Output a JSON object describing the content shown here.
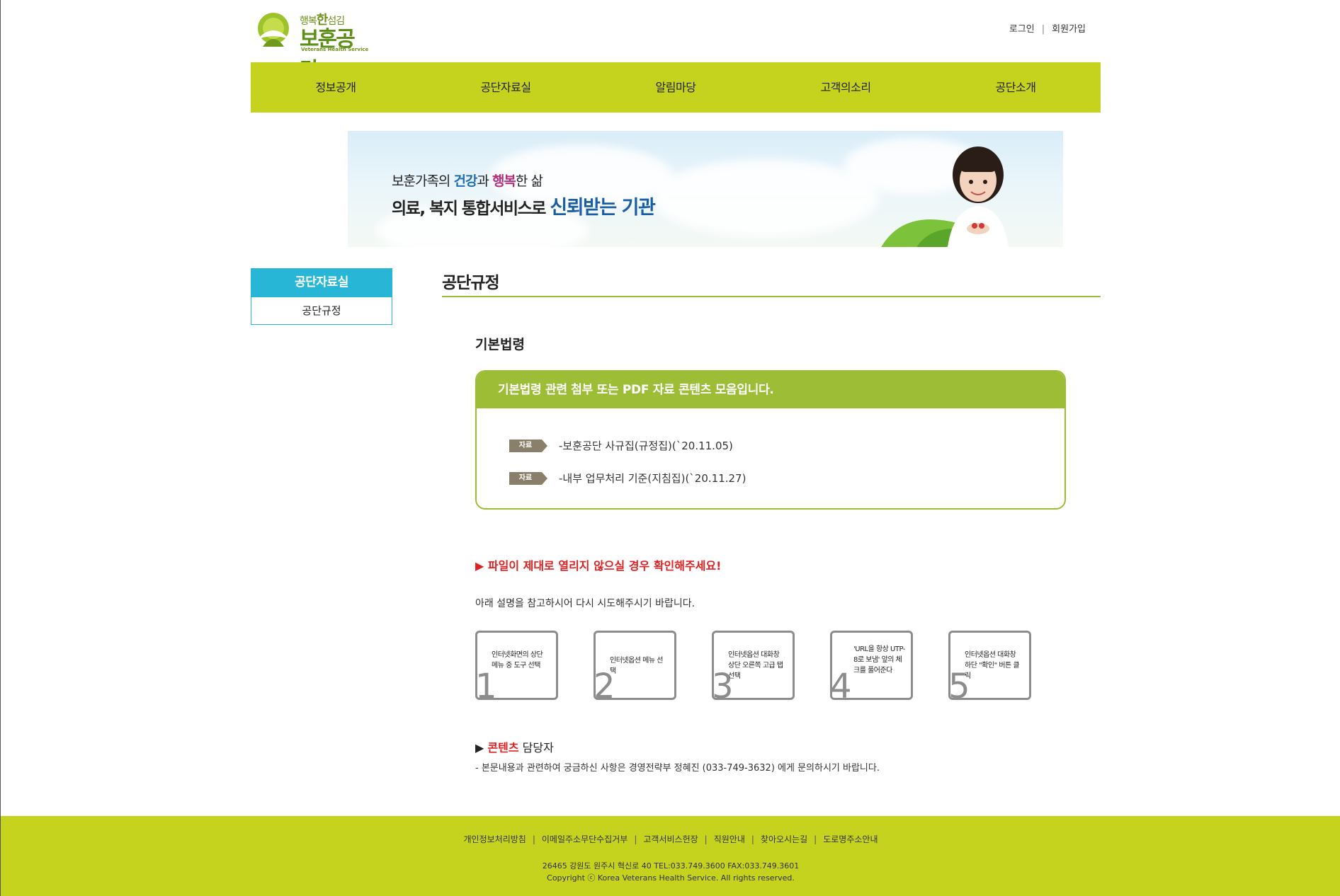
{
  "header": {
    "slogan_pre": "행복",
    "slogan_bold": "한",
    "slogan_post": "섬김",
    "logo_name": "보훈공단",
    "logo_en": "Veterans Health Service",
    "util_links": [
      "로그인",
      "회원가입"
    ]
  },
  "gnb": [
    "정보공개",
    "공단자료실",
    "알림마당",
    "고객의소리",
    "공단소개"
  ],
  "banner": {
    "line1_a": "보훈가족의 ",
    "line1_b": "건강",
    "line1_c": "과 ",
    "line1_d": "행복",
    "line1_e": "한 삶",
    "line2_a": "의료, 복지 통합서비스로 ",
    "line2_b": "신뢰받는 기관"
  },
  "lnb": {
    "title": "공단자료실",
    "item": "공단규정"
  },
  "content": {
    "page_title": "공단규정",
    "section_title": "기본법령",
    "box_title": "기본법령 관련 첨부 또는 PDF 자료 콘텐츠 모음입니다.",
    "tag_label": "자료",
    "files": [
      "-보훈공단 사규집(규정집)(`20.11.05)",
      "-내부 업무처리 기준(지침집)(`20.11.27)"
    ],
    "warn_arrow": "▶",
    "warn_text": "파일이 제대로 열리지 않으실 경우 확인해주세요!",
    "warn_sub": "아래 설명을 참고하시어 다시 시도해주시기 바랍니다.",
    "steps": [
      {
        "num": "1",
        "text": "인터넷화면의 상단 메뉴 중 도구 선택"
      },
      {
        "num": "2",
        "text": "인터넷옵션 메뉴 선택"
      },
      {
        "num": "3",
        "text": "인터넷옵션 대화창 상단 오른쪽 고급 탭 선택"
      },
      {
        "num": "4",
        "text": "'URL을 항상 UTP-8로 보냄' 앞의 체크를 풀어준다"
      },
      {
        "num": "5",
        "text": "인터넷옵션 대화창 하단 \"확인\" 버튼 클릭"
      }
    ],
    "contact_arrow": "▶",
    "contact_red": "콘텐츠",
    "contact_rest": " 담당자",
    "contact_sub": "- 본문내용과 관련하여 궁금하신 사항은 경영전략부 정혜진 (033-749-3632) 에게 문의하시기 바랍니다."
  },
  "footer": {
    "links": [
      "개인정보처리방침",
      "이메일주소무단수집거부",
      "고객서비스헌장",
      "직원안내",
      "찾아오시는길",
      "도로명주소안내"
    ],
    "address": "26465 강원도 원주시 혁신로 40 TEL:033.749.3600 FAX:033.749.3601",
    "copyright": "Copyright ⓒ Korea Veterans Health Service. All rights reserved."
  },
  "colors": {
    "lime": "#c5d31f",
    "green": "#9dbd37",
    "cyan": "#27b6d6",
    "red": "#e02020"
  }
}
